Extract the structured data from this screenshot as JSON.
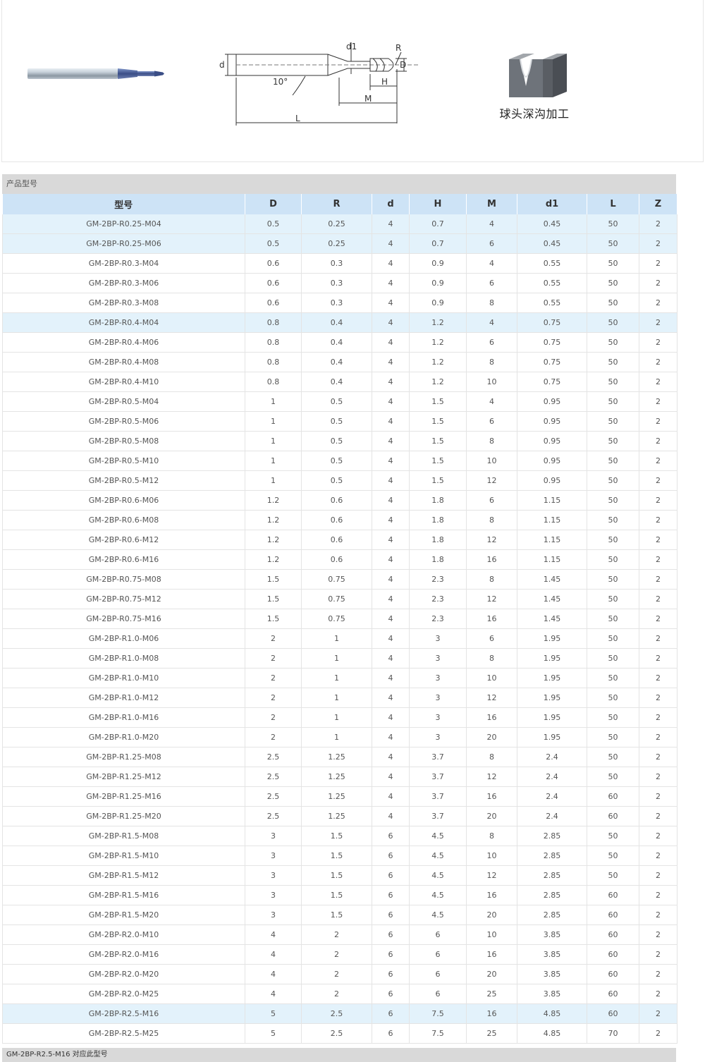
{
  "diagram": {
    "labels": {
      "d": "d",
      "d1": "d1",
      "R": "R",
      "D": "D",
      "angle": "10°",
      "H": "H",
      "M": "M",
      "L": "L"
    },
    "process_label": "球头深沟加工"
  },
  "section_title": "产品型号",
  "table": {
    "headers": [
      "型号",
      "D",
      "R",
      "d",
      "H",
      "M",
      "d1",
      "L",
      "Z"
    ],
    "rows": [
      [
        "GM-2BP-R0.25-M04",
        "0.5",
        "0.25",
        "4",
        "0.7",
        "4",
        "0.45",
        "50",
        "2"
      ],
      [
        "GM-2BP-R0.25-M06",
        "0.5",
        "0.25",
        "4",
        "0.7",
        "6",
        "0.45",
        "50",
        "2"
      ],
      [
        "GM-2BP-R0.3-M04",
        "0.6",
        "0.3",
        "4",
        "0.9",
        "4",
        "0.55",
        "50",
        "2"
      ],
      [
        "GM-2BP-R0.3-M06",
        "0.6",
        "0.3",
        "4",
        "0.9",
        "6",
        "0.55",
        "50",
        "2"
      ],
      [
        "GM-2BP-R0.3-M08",
        "0.6",
        "0.3",
        "4",
        "0.9",
        "8",
        "0.55",
        "50",
        "2"
      ],
      [
        "GM-2BP-R0.4-M04",
        "0.8",
        "0.4",
        "4",
        "1.2",
        "4",
        "0.75",
        "50",
        "2"
      ],
      [
        "GM-2BP-R0.4-M06",
        "0.8",
        "0.4",
        "4",
        "1.2",
        "6",
        "0.75",
        "50",
        "2"
      ],
      [
        "GM-2BP-R0.4-M08",
        "0.8",
        "0.4",
        "4",
        "1.2",
        "8",
        "0.75",
        "50",
        "2"
      ],
      [
        "GM-2BP-R0.4-M10",
        "0.8",
        "0.4",
        "4",
        "1.2",
        "10",
        "0.75",
        "50",
        "2"
      ],
      [
        "GM-2BP-R0.5-M04",
        "1",
        "0.5",
        "4",
        "1.5",
        "4",
        "0.95",
        "50",
        "2"
      ],
      [
        "GM-2BP-R0.5-M06",
        "1",
        "0.5",
        "4",
        "1.5",
        "6",
        "0.95",
        "50",
        "2"
      ],
      [
        "GM-2BP-R0.5-M08",
        "1",
        "0.5",
        "4",
        "1.5",
        "8",
        "0.95",
        "50",
        "2"
      ],
      [
        "GM-2BP-R0.5-M10",
        "1",
        "0.5",
        "4",
        "1.5",
        "10",
        "0.95",
        "50",
        "2"
      ],
      [
        "GM-2BP-R0.5-M12",
        "1",
        "0.5",
        "4",
        "1.5",
        "12",
        "0.95",
        "50",
        "2"
      ],
      [
        "GM-2BP-R0.6-M06",
        "1.2",
        "0.6",
        "4",
        "1.8",
        "6",
        "1.15",
        "50",
        "2"
      ],
      [
        "GM-2BP-R0.6-M08",
        "1.2",
        "0.6",
        "4",
        "1.8",
        "8",
        "1.15",
        "50",
        "2"
      ],
      [
        "GM-2BP-R0.6-M12",
        "1.2",
        "0.6",
        "4",
        "1.8",
        "12",
        "1.15",
        "50",
        "2"
      ],
      [
        "GM-2BP-R0.6-M16",
        "1.2",
        "0.6",
        "4",
        "1.8",
        "16",
        "1.15",
        "50",
        "2"
      ],
      [
        "GM-2BP-R0.75-M08",
        "1.5",
        "0.75",
        "4",
        "2.3",
        "8",
        "1.45",
        "50",
        "2"
      ],
      [
        "GM-2BP-R0.75-M12",
        "1.5",
        "0.75",
        "4",
        "2.3",
        "12",
        "1.45",
        "50",
        "2"
      ],
      [
        "GM-2BP-R0.75-M16",
        "1.5",
        "0.75",
        "4",
        "2.3",
        "16",
        "1.45",
        "50",
        "2"
      ],
      [
        "GM-2BP-R1.0-M06",
        "2",
        "1",
        "4",
        "3",
        "6",
        "1.95",
        "50",
        "2"
      ],
      [
        "GM-2BP-R1.0-M08",
        "2",
        "1",
        "4",
        "3",
        "8",
        "1.95",
        "50",
        "2"
      ],
      [
        "GM-2BP-R1.0-M10",
        "2",
        "1",
        "4",
        "3",
        "10",
        "1.95",
        "50",
        "2"
      ],
      [
        "GM-2BP-R1.0-M12",
        "2",
        "1",
        "4",
        "3",
        "12",
        "1.95",
        "50",
        "2"
      ],
      [
        "GM-2BP-R1.0-M16",
        "2",
        "1",
        "4",
        "3",
        "16",
        "1.95",
        "50",
        "2"
      ],
      [
        "GM-2BP-R1.0-M20",
        "2",
        "1",
        "4",
        "3",
        "20",
        "1.95",
        "50",
        "2"
      ],
      [
        "GM-2BP-R1.25-M08",
        "2.5",
        "1.25",
        "4",
        "3.7",
        "8",
        "2.4",
        "50",
        "2"
      ],
      [
        "GM-2BP-R1.25-M12",
        "2.5",
        "1.25",
        "4",
        "3.7",
        "12",
        "2.4",
        "50",
        "2"
      ],
      [
        "GM-2BP-R1.25-M16",
        "2.5",
        "1.25",
        "4",
        "3.7",
        "16",
        "2.4",
        "60",
        "2"
      ],
      [
        "GM-2BP-R1.25-M20",
        "2.5",
        "1.25",
        "4",
        "3.7",
        "20",
        "2.4",
        "60",
        "2"
      ],
      [
        "GM-2BP-R1.5-M08",
        "3",
        "1.5",
        "6",
        "4.5",
        "8",
        "2.85",
        "50",
        "2"
      ],
      [
        "GM-2BP-R1.5-M10",
        "3",
        "1.5",
        "6",
        "4.5",
        "10",
        "2.85",
        "50",
        "2"
      ],
      [
        "GM-2BP-R1.5-M12",
        "3",
        "1.5",
        "6",
        "4.5",
        "12",
        "2.85",
        "50",
        "2"
      ],
      [
        "GM-2BP-R1.5-M16",
        "3",
        "1.5",
        "6",
        "4.5",
        "16",
        "2.85",
        "60",
        "2"
      ],
      [
        "GM-2BP-R1.5-M20",
        "3",
        "1.5",
        "6",
        "4.5",
        "20",
        "2.85",
        "60",
        "2"
      ],
      [
        "GM-2BP-R2.0-M10",
        "4",
        "2",
        "6",
        "6",
        "10",
        "3.85",
        "60",
        "2"
      ],
      [
        "GM-2BP-R2.0-M16",
        "4",
        "2",
        "6",
        "6",
        "16",
        "3.85",
        "60",
        "2"
      ],
      [
        "GM-2BP-R2.0-M20",
        "4",
        "2",
        "6",
        "6",
        "20",
        "3.85",
        "60",
        "2"
      ],
      [
        "GM-2BP-R2.0-M25",
        "4",
        "2",
        "6",
        "6",
        "25",
        "3.85",
        "60",
        "2"
      ],
      [
        "GM-2BP-R2.5-M16",
        "5",
        "2.5",
        "6",
        "7.5",
        "16",
        "4.85",
        "60",
        "2"
      ],
      [
        "GM-2BP-R2.5-M25",
        "5",
        "2.5",
        "6",
        "7.5",
        "25",
        "4.85",
        "70",
        "2"
      ]
    ],
    "highlighted_rows": [
      0,
      1,
      5,
      40
    ]
  },
  "bottom_section_title": "GM-2BP-R2.5-M16 对应此型号"
}
